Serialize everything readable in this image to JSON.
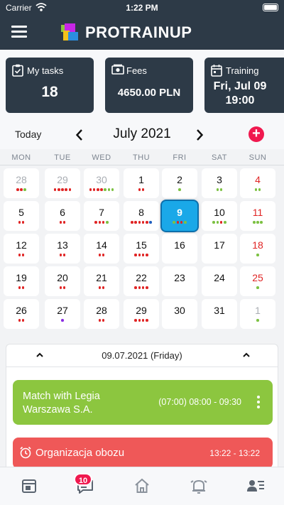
{
  "status": {
    "carrier": "Carrier",
    "time": "1:22 PM"
  },
  "brand": {
    "name": "PROTRAINUP"
  },
  "cards": [
    {
      "label": "My tasks",
      "value": "18",
      "icon": "clipboard-icon"
    },
    {
      "label": "Fees",
      "value": "4650.00 PLN",
      "icon": "money-icon"
    },
    {
      "label": "Training",
      "value_line1": "Fri, Jul 09",
      "value_line2": "19:00",
      "icon": "calendar-icon"
    }
  ],
  "calendar": {
    "today_label": "Today",
    "month_label": "July 2021",
    "weekdays": [
      "MON",
      "TUE",
      "WED",
      "THU",
      "FRI",
      "SAT",
      "SUN"
    ],
    "colors": {
      "red": "#e02424",
      "green": "#7cc142",
      "blue": "#1f5fbf",
      "purple": "#8a2be2",
      "selected": "#1aa8e8"
    },
    "weeks": [
      [
        {
          "d": "28",
          "muted": true,
          "dots": [
            "r",
            "r",
            "g"
          ]
        },
        {
          "d": "29",
          "muted": true,
          "dots": [
            "r",
            "r",
            "r",
            "r",
            "r"
          ]
        },
        {
          "d": "30",
          "muted": true,
          "dots": [
            "r",
            "r",
            "r",
            "r",
            "g",
            "g",
            "g"
          ]
        },
        {
          "d": "1",
          "dots": [
            "r",
            "r"
          ]
        },
        {
          "d": "2",
          "dots": [
            "g"
          ]
        },
        {
          "d": "3",
          "dots": [
            "g",
            "g"
          ]
        },
        {
          "d": "4",
          "sunday": true,
          "dots": [
            "g",
            "g"
          ]
        }
      ],
      [
        {
          "d": "5",
          "dots": [
            "r",
            "r"
          ]
        },
        {
          "d": "6",
          "dots": [
            "r",
            "r"
          ]
        },
        {
          "d": "7",
          "dots": [
            "r",
            "r",
            "r",
            "g"
          ]
        },
        {
          "d": "8",
          "dots": [
            "r",
            "r",
            "r",
            "r",
            "r",
            "b"
          ]
        },
        {
          "d": "9",
          "selected": true,
          "dots": [
            "g",
            "r",
            "r",
            "g"
          ]
        },
        {
          "d": "10",
          "dots": [
            "g",
            "g",
            "r",
            "g"
          ]
        },
        {
          "d": "11",
          "sunday": true,
          "dots": [
            "g",
            "g",
            "g"
          ]
        }
      ],
      [
        {
          "d": "12",
          "dots": [
            "r",
            "r"
          ]
        },
        {
          "d": "13",
          "dots": [
            "r",
            "r"
          ]
        },
        {
          "d": "14",
          "dots": [
            "r",
            "r"
          ]
        },
        {
          "d": "15",
          "dots": [
            "r",
            "r",
            "r",
            "r"
          ]
        },
        {
          "d": "16",
          "dots": []
        },
        {
          "d": "17",
          "dots": []
        },
        {
          "d": "18",
          "sunday": true,
          "dots": [
            "g"
          ]
        }
      ],
      [
        {
          "d": "19",
          "dots": [
            "r",
            "r"
          ]
        },
        {
          "d": "20",
          "dots": [
            "r",
            "r"
          ]
        },
        {
          "d": "21",
          "dots": [
            "r",
            "r"
          ]
        },
        {
          "d": "22",
          "dots": [
            "r",
            "r",
            "r",
            "r"
          ]
        },
        {
          "d": "23",
          "dots": []
        },
        {
          "d": "24",
          "dots": []
        },
        {
          "d": "25",
          "sunday": true,
          "dots": [
            "g"
          ]
        }
      ],
      [
        {
          "d": "26",
          "dots": [
            "r",
            "r"
          ]
        },
        {
          "d": "27",
          "dots": [
            "p"
          ]
        },
        {
          "d": "28",
          "dots": [
            "r",
            "r"
          ]
        },
        {
          "d": "29",
          "dots": [
            "r",
            "r",
            "r",
            "r"
          ]
        },
        {
          "d": "30",
          "dots": []
        },
        {
          "d": "31",
          "dots": []
        },
        {
          "d": "1",
          "muted": true,
          "dots": [
            "g"
          ]
        }
      ]
    ]
  },
  "day": {
    "title": "09.07.2021 (Friday)",
    "events": [
      {
        "title": "Match with Legia Warszawa S.A.",
        "times": "(07:00)  08:00 - 09:30",
        "color": "#8cc63f"
      },
      {
        "title": "Organizacja obozu",
        "times": "13:22 - 13:22",
        "color": "#ef5858"
      }
    ]
  },
  "tabs": {
    "messages_badge": "10"
  }
}
